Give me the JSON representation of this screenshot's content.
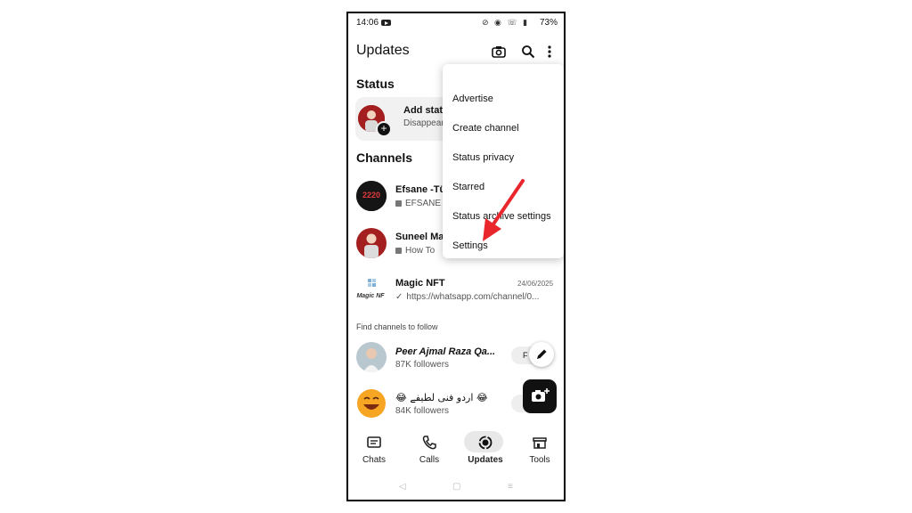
{
  "status_bar": {
    "time": "14:06",
    "battery": "73%"
  },
  "app_bar": {
    "title": "Updates"
  },
  "status_section": {
    "heading": "Status",
    "add_title": "Add stat",
    "add_subtitle": "Disappear"
  },
  "channels_section": {
    "heading": "Channels",
    "items": [
      {
        "name": "Efsane -Tü",
        "message": "EFSANE",
        "avatar_text": "2220"
      },
      {
        "name": "Suneel Ma",
        "message": "How To"
      },
      {
        "name": "Magic NFT",
        "message": "https://whatsapp.com/channel/0...",
        "date": "24/06/2025",
        "avatar_text": "Magic NF"
      }
    ]
  },
  "find_channels": {
    "label": "Find channels to follow",
    "items": [
      {
        "name": "Peer Ajmal Raza Qa...",
        "followers": "87K followers",
        "button": "F"
      },
      {
        "name": "😂 اردو فنی لطیفے 😂",
        "followers": "84K followers",
        "button": ""
      }
    ]
  },
  "bottom_nav": {
    "items": [
      {
        "label": "Chats",
        "icon": "chat-icon"
      },
      {
        "label": "Calls",
        "icon": "phone-icon"
      },
      {
        "label": "Updates",
        "icon": "updates-icon",
        "active": true
      },
      {
        "label": "Tools",
        "icon": "store-icon"
      }
    ]
  },
  "overflow_menu": {
    "items": [
      "Advertise",
      "Create channel",
      "Status privacy",
      "Starred",
      "Status archive settings",
      "Settings"
    ]
  },
  "colors": {
    "accent": "#111111",
    "annotation_arrow": "#e8262c",
    "card_bg": "#f1f1f1"
  }
}
